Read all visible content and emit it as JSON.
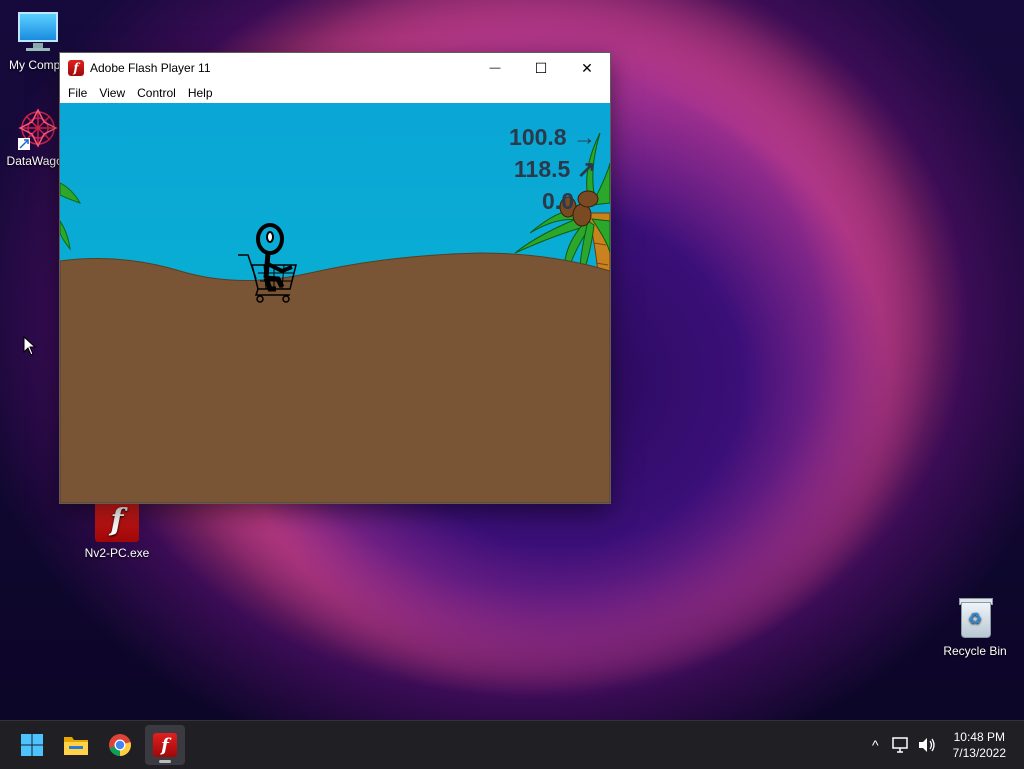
{
  "desktop": {
    "icons": [
      {
        "label": "My Compu",
        "icon": "computer-icon"
      },
      {
        "label": "DataWagon",
        "icon": "datawagon-icon"
      },
      {
        "label": "Nv2-PC.exe",
        "icon": "flash-icon"
      },
      {
        "label": "Recycle Bin",
        "icon": "recycle-bin-icon"
      }
    ]
  },
  "window": {
    "title": "Adobe Flash Player 11",
    "app_icon_glyph": "f",
    "controls": {
      "minimize": "—",
      "maximize": "☐",
      "close": "✕"
    },
    "menu": [
      "File",
      "View",
      "Control",
      "Help"
    ]
  },
  "game": {
    "hud": [
      {
        "value": "100.8",
        "arrow": "→"
      },
      {
        "value": "118.5",
        "arrow": "↗"
      },
      {
        "value": "0.0",
        "arrow": ""
      }
    ],
    "colors": {
      "sky": "#0aa6d6",
      "sand": "#7a5535",
      "palm_leaf": "#2ba82b",
      "trunk": "#c8821e"
    }
  },
  "taskbar": {
    "apps": [
      "start-icon",
      "file-explorer-icon",
      "chrome-icon",
      "flash-icon"
    ],
    "tray": {
      "chevron": "^",
      "network": "network-icon",
      "volume": "volume-icon"
    },
    "clock": {
      "time": "10:48 PM",
      "date": "7/13/2022"
    }
  }
}
